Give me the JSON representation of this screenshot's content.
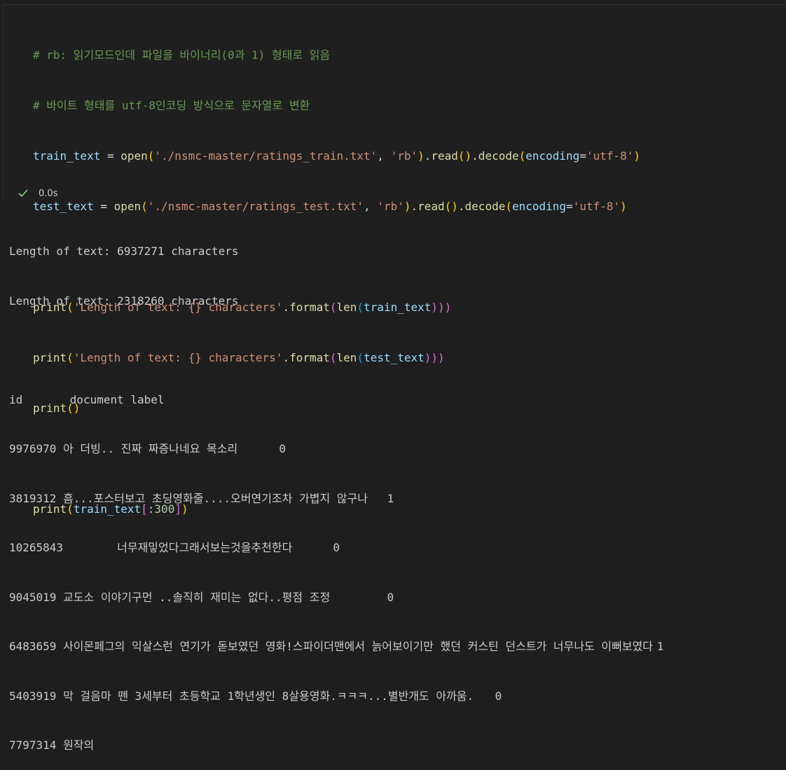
{
  "code_cell": {
    "comment_1": "# rb: 읽기모드인데 파일을 바이너리(0과 1) 형태로 읽음",
    "comment_2": "# 바이트 형태를 utf-8인코딩 방식으로 문자열로 변환",
    "line_3": {
      "var": "train_text",
      "eq": " = ",
      "fn_open": "open",
      "p1": "(",
      "path": "'./nsmc-master/ratings_train.txt'",
      "comma": ", ",
      "mode": "'rb'",
      "p2": ")",
      "dot_read": ".read",
      "read_paren": "()",
      "dot_decode": ".decode",
      "p3": "(",
      "kw": "encoding",
      "eq2": "=",
      "enc": "'utf-8'",
      "p4": ")"
    },
    "line_4": {
      "var": "test_text",
      "eq": " = ",
      "fn_open": "open",
      "p1": "(",
      "path": "'./nsmc-master/ratings_test.txt'",
      "comma": ", ",
      "mode": "'rb'",
      "p2": ")",
      "dot_read": ".read",
      "read_paren": "()",
      "dot_decode": ".decode",
      "p3": "(",
      "kw": "encoding",
      "eq2": "=",
      "enc": "'utf-8'",
      "p4": ")"
    },
    "line_6": {
      "fn": "print",
      "p1": "(",
      "str": "'Length of text: {} characters'",
      "dot_format": ".format",
      "p2": "(",
      "len": "len",
      "p3": "(",
      "arg": "train_text",
      "close": ")))"
    },
    "line_7": {
      "fn": "print",
      "p1": "(",
      "str": "'Length of text: {} characters'",
      "dot_format": ".format",
      "p2": "(",
      "len": "len",
      "p3": "(",
      "arg": "test_text",
      "close": ")))"
    },
    "line_8": {
      "fn": "print",
      "parens": "()"
    },
    "line_10": {
      "fn": "print",
      "p1": "(",
      "arg": "train_text",
      "b1": "[",
      "colon": ":",
      "num": "300",
      "b2": "]",
      "p2": ")"
    }
  },
  "status": {
    "icon": "check-icon",
    "duration": "0.0s",
    "color": "#89d185"
  },
  "output": {
    "lines": [
      "Length of text: 6937271 characters",
      "Length of text: 2318260 characters",
      "",
      "id\tdocument\tlabel",
      "9976970\t아 더빙.. 진짜 짜증나네요 목소리\t0",
      "3819312\t흠...포스터보고 초딩영화줄....오버연기조차 가볍지 않구나\t1",
      "10265843\t너무재밓었다그래서보는것을추천한다\t0",
      "9045019\t교도소 이야기구먼 ..솔직히 재미는 없다..평점 조정\t0",
      "6483659\t사이몬페그의 익살스런 연기가 돋보였던 영화!스파이더맨에서 늙어보이기만 했던 커스틴 던스트가 너무나도 이뻐보였다\t1",
      "5403919\t막 걸음마 뗀 3세부터 초등학교 1학년생인 8살용영화.ㅋㅋㅋ...별반개도 아까움.\t0",
      "7797314\t원작의"
    ]
  }
}
